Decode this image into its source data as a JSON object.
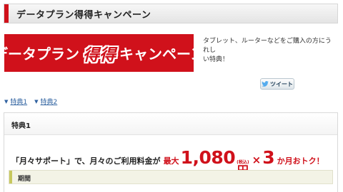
{
  "header": {
    "title": "データプラン得得キャンペーン"
  },
  "banner": {
    "text_before": "データプラン",
    "text_emph": "得得",
    "text_after": "キャンペーン"
  },
  "intro": {
    "line1": "タブレット、ルーターなどをご購入の方にうれし",
    "line2": "い特典！"
  },
  "tweet": {
    "label": "ツイート",
    "icon": "twitter-bird-icon"
  },
  "links": [
    {
      "label": "特典1"
    },
    {
      "label": "特典2"
    }
  ],
  "benefit": {
    "title": "特典1",
    "promo_prefix": "「月々サポート」で、月々のご利用料金が",
    "max_label": "最大",
    "amount": "1,080",
    "tax_note": "(税込)",
    "yen": "円",
    "times": "×",
    "months": "3",
    "suffix": "か月おトク！"
  },
  "period": {
    "label": "期間"
  },
  "colors": {
    "brand_red": "#d0111b",
    "link_blue": "#2f62a0"
  }
}
